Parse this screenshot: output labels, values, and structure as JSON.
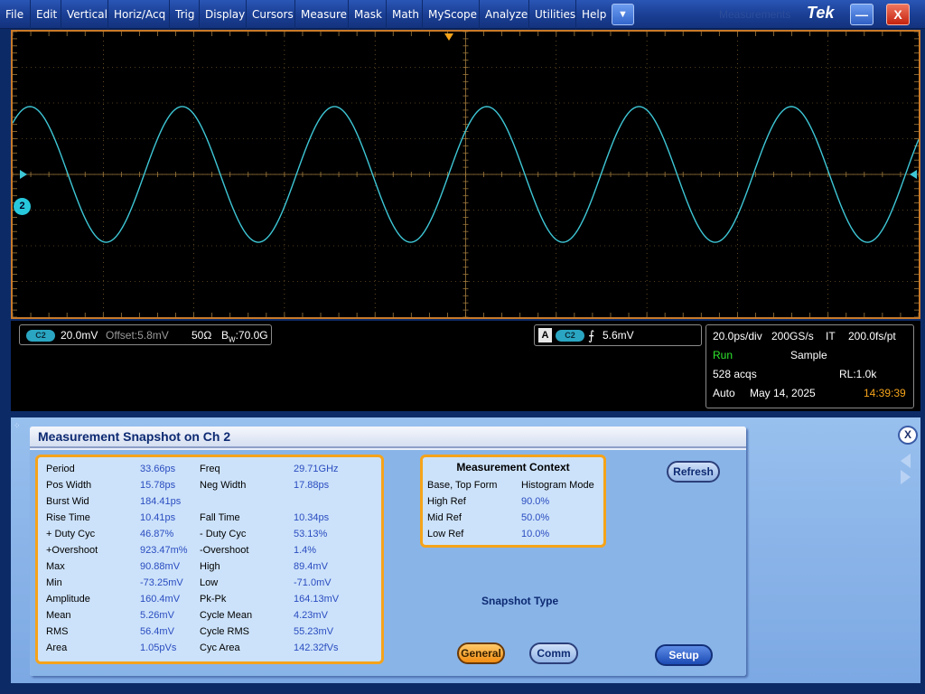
{
  "menu": {
    "items": [
      "File",
      "Edit",
      "Vertical",
      "Horiz/Acq",
      "Trig",
      "Display",
      "Cursors",
      "Measure",
      "Mask",
      "Math",
      "MyScope",
      "Analyze",
      "Utilities",
      "Help"
    ],
    "dropdown_glyph": "▼",
    "faded_text": "Measurements",
    "logo": "Tek",
    "minimize_glyph": "—",
    "close_glyph": "X"
  },
  "colors": {
    "trace": "#3ec7d6",
    "grid": "#a07a3c",
    "accent": "#f5a31a",
    "menubar": "#1a3e93",
    "trigger_marker": "#f5a31a"
  },
  "channel": {
    "marker": "2",
    "badge": "C2",
    "scale": "20.0mV",
    "offset": "Offset:5.8mV",
    "impedance": "50Ω",
    "bandwidth_prefix": "B",
    "bandwidth_sub": "W",
    "bandwidth": ":70.0G"
  },
  "trigger": {
    "source_letter": "A",
    "badge": "C2",
    "slope_glyph": "⨍",
    "level": "5.6mV"
  },
  "acquisition": {
    "timebase": "20.0ps/div",
    "sample_rate": "200GS/s",
    "mode_tag": "IT",
    "resolution": "200.0fs/pt",
    "state": "Run",
    "acq_mode": "Sample",
    "acq_count": "528 acqs",
    "record_length": "RL:1.0k",
    "trigger_mode": "Auto",
    "date": "May 14, 2025",
    "time": "14:39:39"
  },
  "waveform": {
    "type": "sine",
    "cycles_visible": 5.95,
    "amplitude_divisions": 1.9
  },
  "snapshot": {
    "title": "Measurement Snapshot on Ch 2",
    "measurements_left": [
      {
        "label": "Period",
        "value": "33.66ps"
      },
      {
        "label": "Pos Width",
        "value": "15.78ps"
      },
      {
        "label": "Burst Wid",
        "value": "184.41ps"
      },
      {
        "label": "Rise Time",
        "value": "10.41ps"
      },
      {
        "label": "+ Duty Cyc",
        "value": "46.87%"
      },
      {
        "label": "+Overshoot",
        "value": "923.47m%"
      },
      {
        "label": "Max",
        "value": "90.88mV"
      },
      {
        "label": "Min",
        "value": "-73.25mV"
      },
      {
        "label": "Amplitude",
        "value": "160.4mV"
      },
      {
        "label": "Mean",
        "value": "5.26mV"
      },
      {
        "label": "RMS",
        "value": "56.4mV"
      },
      {
        "label": "Area",
        "value": "1.05pVs"
      }
    ],
    "measurements_right": [
      {
        "label": "Freq",
        "value": "29.71GHz"
      },
      {
        "label": "Neg Width",
        "value": "17.88ps"
      },
      {
        "label": "",
        "value": ""
      },
      {
        "label": "Fall Time",
        "value": "10.34ps"
      },
      {
        "label": "- Duty Cyc",
        "value": "53.13%"
      },
      {
        "label": "-Overshoot",
        "value": "1.4%"
      },
      {
        "label": "High",
        "value": "89.4mV"
      },
      {
        "label": "Low",
        "value": "-71.0mV"
      },
      {
        "label": "Pk-Pk",
        "value": "164.13mV"
      },
      {
        "label": "Cycle Mean",
        "value": "4.23mV"
      },
      {
        "label": "Cycle RMS",
        "value": "55.23mV"
      },
      {
        "label": "Cyc Area",
        "value": "142.32fVs"
      }
    ],
    "context": {
      "title": "Measurement Context",
      "base_top_label": "Base, Top Form",
      "base_top_value": "Histogram Mode",
      "high_ref_label": "High Ref",
      "high_ref": "90.0%",
      "mid_ref_label": "Mid Ref",
      "mid_ref": "50.0%",
      "low_ref_label": "Low Ref",
      "low_ref": "10.0%"
    },
    "refresh_label": "Refresh",
    "snapshot_type_label": "Snapshot Type",
    "general_label": "General",
    "comm_label": "Comm",
    "setup_label": "Setup",
    "close_glyph": "X",
    "grip_glyph": "⁘"
  }
}
